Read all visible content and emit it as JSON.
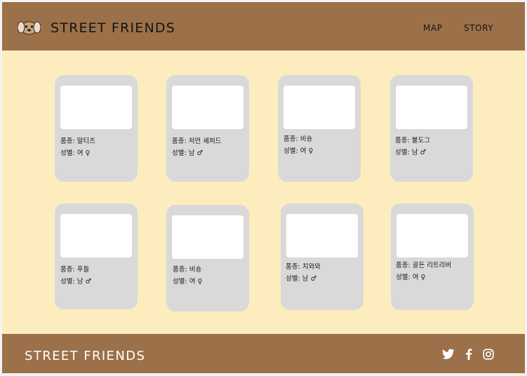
{
  "header": {
    "logo_icon": "dog-face-icon",
    "brand": "STREET FRIENDS",
    "nav": [
      {
        "label": "MAP"
      },
      {
        "label": "STORY"
      }
    ]
  },
  "cards": [
    {
      "breed": "품종: 말티즈",
      "gender": "성별: 여 ♀"
    },
    {
      "breed": "품종: 저먼 셰퍼드",
      "gender": "성별: 남 ♂"
    },
    {
      "breed": "품종: 비숑",
      "gender": "성별: 여 ♀"
    },
    {
      "breed": "품종: 불도그",
      "gender": "성별: 남 ♂"
    },
    {
      "breed": "품종: 푸들",
      "gender": "성별: 남 ♂"
    },
    {
      "breed": "품종: 비숑",
      "gender": "성별: 여 ♀"
    },
    {
      "breed": "품종: 치와와",
      "gender": "성별: 남 ♂"
    },
    {
      "breed": "품종: 골든 리트리버",
      "gender": "성별: 여 ♀"
    }
  ],
  "footer": {
    "brand": "STREET FRIENDS",
    "social": [
      "twitter-icon",
      "facebook-icon",
      "instagram-icon"
    ]
  },
  "colors": {
    "header_bg": "#9c714a",
    "page_bg": "#fdedbe",
    "card_bg": "#d9d9d9"
  }
}
